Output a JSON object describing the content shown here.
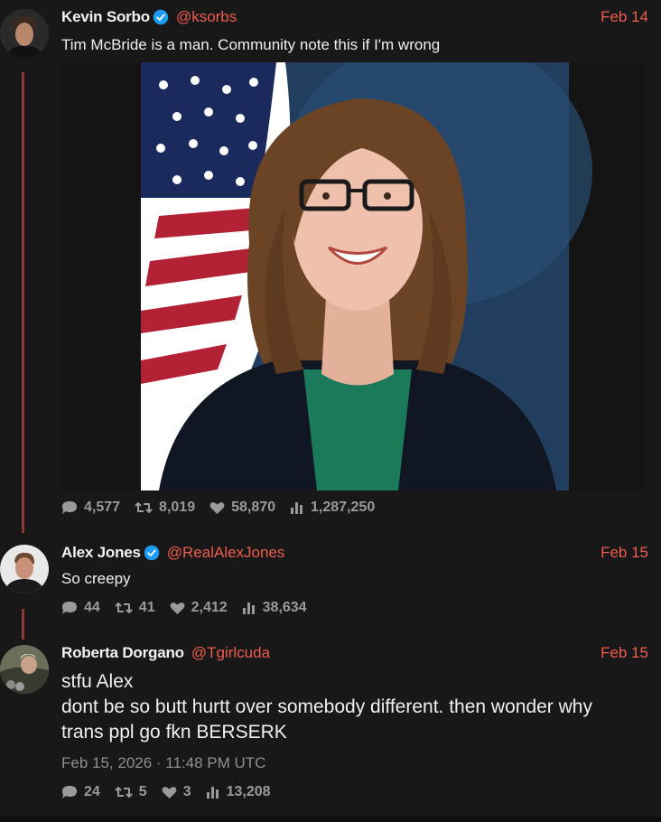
{
  "tweets": [
    {
      "name": "Kevin Sorbo",
      "handle": "@ksorbs",
      "date": "Feb 14",
      "text": "Tim McBride is a man. Community note this if I'm wrong",
      "stats": {
        "replies": "4,577",
        "retweets": "8,019",
        "likes": "58,870",
        "views": "1,287,250"
      }
    },
    {
      "name": "Alex Jones",
      "handle": "@RealAlexJones",
      "date": "Feb 15",
      "text": "So creepy",
      "stats": {
        "replies": "44",
        "retweets": "41",
        "likes": "2,412",
        "views": "38,634"
      }
    },
    {
      "name": "Roberta Dorgano",
      "handle": "@Tgirlcuda",
      "date": "Feb 15",
      "text_lines": [
        "stfu Alex",
        "dont be so butt hurtt over somebody different. then wonder why",
        "trans ppl go fkn BERSERK"
      ],
      "timestamp": "Feb 15, 2026 · 11:48 PM UTC",
      "stats": {
        "replies": "24",
        "retweets": "5",
        "likes": "3",
        "views": "13,208"
      }
    }
  ],
  "colors": {
    "accent": "#ef5c4e",
    "thread_line": "#8c3b33",
    "verified": "#1d9bf0",
    "background": "#181818"
  }
}
